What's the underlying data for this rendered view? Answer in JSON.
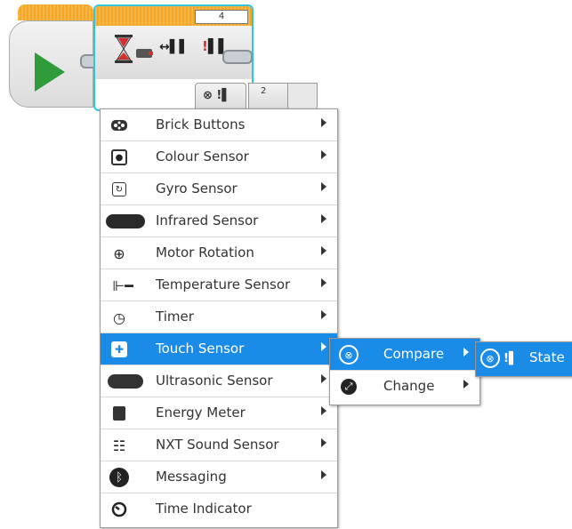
{
  "wait_block": {
    "port_number": "4",
    "threshold_value": "2"
  },
  "menu": {
    "items": [
      {
        "label": "Brick Buttons",
        "icon": "brick-buttons-icon",
        "has_submenu": true
      },
      {
        "label": "Colour Sensor",
        "icon": "colour-sensor-icon",
        "has_submenu": true
      },
      {
        "label": "Gyro Sensor",
        "icon": "gyro-sensor-icon",
        "has_submenu": true
      },
      {
        "label": "Infrared Sensor",
        "icon": "infrared-sensor-icon",
        "has_submenu": true
      },
      {
        "label": "Motor Rotation",
        "icon": "motor-rotation-icon",
        "has_submenu": true
      },
      {
        "label": "Temperature Sensor",
        "icon": "temperature-sensor-icon",
        "has_submenu": true
      },
      {
        "label": "Timer",
        "icon": "timer-icon",
        "has_submenu": true
      },
      {
        "label": "Touch Sensor",
        "icon": "touch-sensor-icon",
        "has_submenu": true,
        "selected": true
      },
      {
        "label": "Ultrasonic Sensor",
        "icon": "ultrasonic-sensor-icon",
        "has_submenu": true
      },
      {
        "label": "Energy Meter",
        "icon": "energy-meter-icon",
        "has_submenu": true
      },
      {
        "label": "NXT Sound Sensor",
        "icon": "nxt-sound-sensor-icon",
        "has_submenu": true
      },
      {
        "label": "Messaging",
        "icon": "messaging-icon",
        "has_submenu": true
      },
      {
        "label": "Time Indicator",
        "icon": "time-indicator-icon",
        "has_submenu": false
      }
    ]
  },
  "submenu": {
    "items": [
      {
        "label": "Compare",
        "icon": "compare-icon",
        "selected": true
      },
      {
        "label": "Change",
        "icon": "change-icon",
        "selected": false
      }
    ]
  },
  "submenu2": {
    "items": [
      {
        "label": "State",
        "icon": "state-icon",
        "selected": true
      }
    ]
  },
  "colors": {
    "accent": "#1a8ce8",
    "block_header": "#f5a623",
    "block_selected_border": "#2ec7e0",
    "start_play": "#2e9c3a"
  }
}
